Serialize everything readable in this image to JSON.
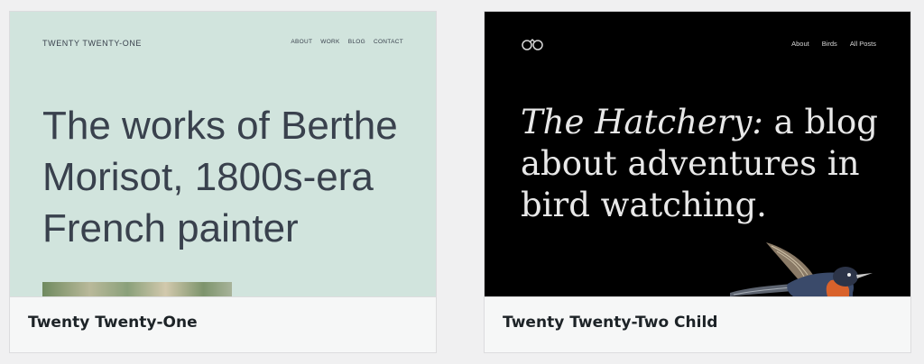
{
  "themes": [
    {
      "name": "Twenty Twenty-One",
      "preview": {
        "site_title": "TWENTY TWENTY-ONE",
        "nav": [
          "ABOUT",
          "WORK",
          "BLOG",
          "CONTACT"
        ],
        "headline": "The works of Berthe Morisot, 1800s-era French painter",
        "background": "#d1e4dd",
        "text_color": "#39414d"
      }
    },
    {
      "name": "Twenty Twenty-Two Child",
      "preview": {
        "logo_icon": "binoculars-icon",
        "nav": [
          "About",
          "Birds",
          "All Posts"
        ],
        "headline_italic": "The Hatchery:",
        "headline_rest": " a blog about adventures in bird watching.",
        "background": "#000000",
        "text_color": "#e8e8e8"
      }
    }
  ]
}
